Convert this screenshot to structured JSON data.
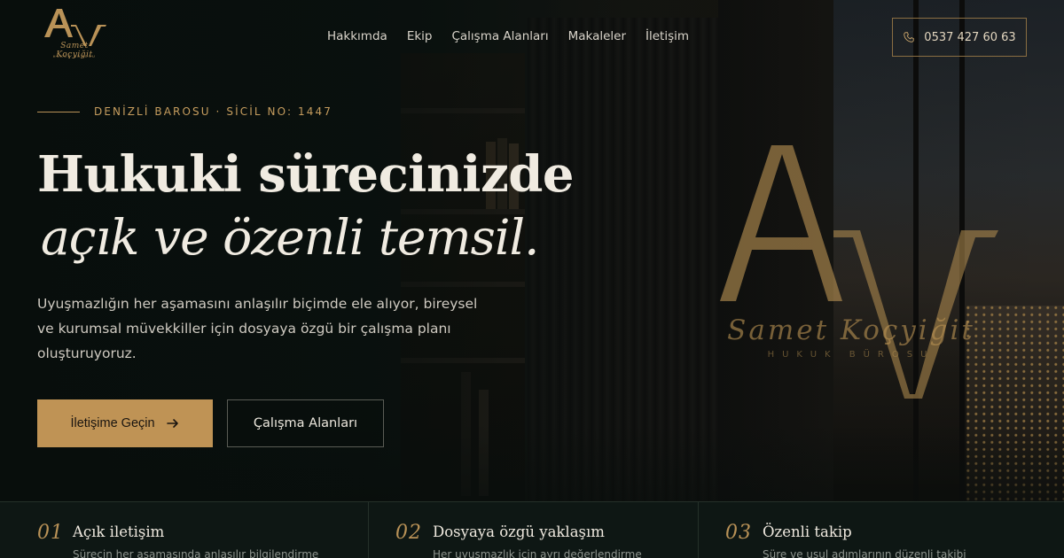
{
  "brand": {
    "logo_script": "Samet Koçyiğit",
    "logo_sub": "HUKUK BÜROSU"
  },
  "nav": {
    "items": [
      {
        "label": "Hakkımda"
      },
      {
        "label": "Ekip"
      },
      {
        "label": "Çalışma Alanları"
      },
      {
        "label": "Makaleler"
      },
      {
        "label": "İletişim"
      }
    ]
  },
  "header": {
    "phone": "0537 427 60 63",
    "phone_icon": "phone-icon"
  },
  "hero": {
    "eyebrow": "DENİZLİ BAROSU · SİCİL NO: 1447",
    "title_line1": "Hukuki sürecinizde",
    "title_line2": "açık ve özenli temsil.",
    "lead": "Uyuşmazlığın her aşamasını anlaşılır biçimde ele alıyor, bireysel ve kurumsal müvekkiller için dosyaya özgü bir çalışma planı oluşturuyoruz.",
    "primary_cta": "İletişime Geçin",
    "primary_cta_icon": "arrow-right-icon",
    "secondary_cta": "Çalışma Alanları"
  },
  "watermark": {
    "script": "Samet Koçyiğit",
    "sub": "HUKUK BÜROSU"
  },
  "features": [
    {
      "num": "01",
      "title": "Açık iletişim",
      "desc": "Sürecin her aşamasında anlaşılır bilgilendirme"
    },
    {
      "num": "02",
      "title": "Dosyaya özgü yaklaşım",
      "desc": "Her uyuşmazlık için ayrı değerlendirme"
    },
    {
      "num": "03",
      "title": "Özenli takip",
      "desc": "Süre ve usul adımlarının düzenli takibi"
    }
  ],
  "colors": {
    "accent_gold": "#bf9355",
    "background": "#0b1210",
    "text_light": "#f0ebe1"
  }
}
